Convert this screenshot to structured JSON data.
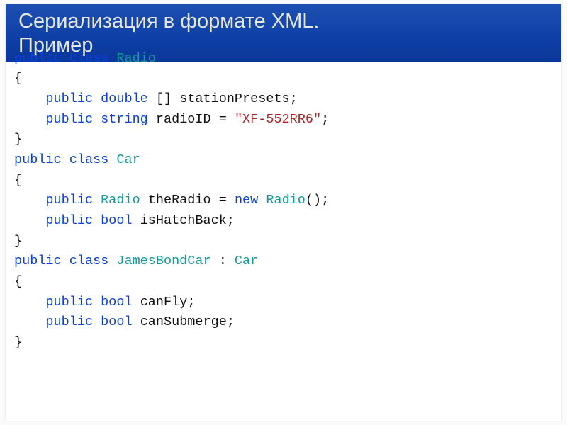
{
  "header": {
    "line1": "Сериализация в формате XML.",
    "line2": "Пример"
  },
  "code": {
    "kw_public": "public",
    "kw_class": "class",
    "kw_double": "double",
    "kw_string": "string",
    "kw_bool": "bool",
    "kw_new": "new",
    "type_radio": "Radio",
    "type_car": "Car",
    "type_jbc": "JamesBondCar",
    "id_stationPresets": "stationPresets",
    "id_radioID": "radioID",
    "id_theRadio": "theRadio",
    "id_isHatchBack": "isHatchBack",
    "id_canFly": "canFly",
    "id_canSubmerge": "canSubmerge",
    "lit_xf": "\"XF-552RR6\"",
    "brace_open": "{",
    "brace_close": "}",
    "brackets_empty": "[]",
    "parens_empty": "()",
    "semi": ";",
    "eq": "=",
    "colon": ":",
    "indent": "    "
  }
}
